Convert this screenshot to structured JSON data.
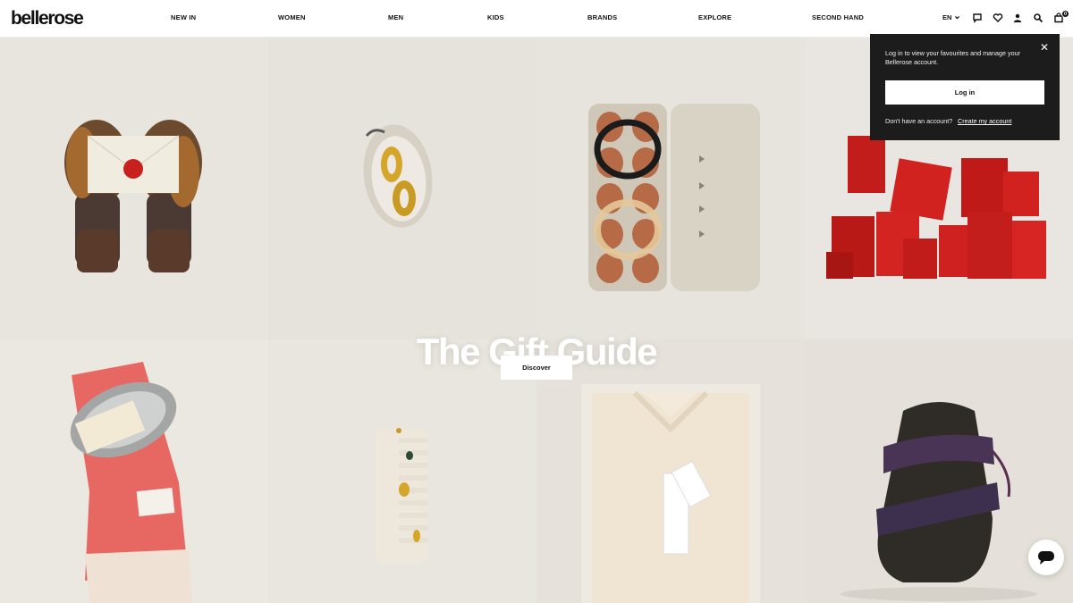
{
  "header": {
    "logo": "bellerose",
    "nav": [
      "NEW IN",
      "WOMEN",
      "MEN",
      "KIDS",
      "BRANDS",
      "EXPLORE",
      "SECOND HAND"
    ],
    "language": "EN",
    "icons": [
      "chat-icon",
      "heart-icon",
      "account-icon",
      "search-icon",
      "bag-icon"
    ],
    "bag_count": "0"
  },
  "hero": {
    "title": "The Gift Guide",
    "cta": "Discover",
    "tiles": [
      "mittens-with-letter",
      "oyster-with-earrings",
      "egg-carton-with-bangles",
      "red-gift-boxes",
      "pink-scarf-with-tray",
      "comb-with-jewelry",
      "wrapped-shirt-for-her",
      "boot-wrapped-in-tie"
    ]
  },
  "login_popover": {
    "message": "Log in to view your favourites and manage your Bellerose account.",
    "login_button": "Log in",
    "no_account": "Don't have an account?",
    "create_link": "Create my account"
  },
  "colors": {
    "header_bg": "#ffffff",
    "popover_bg": "#1c1c1c",
    "text": "#111111",
    "gift_red": "#c8201e"
  }
}
